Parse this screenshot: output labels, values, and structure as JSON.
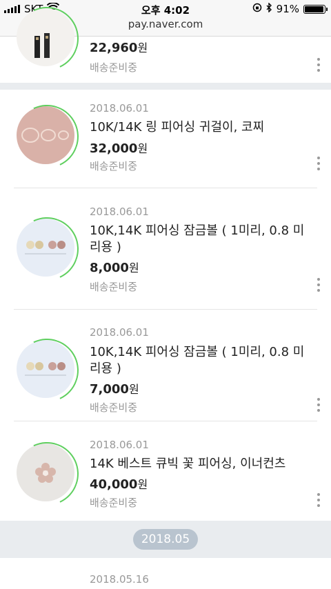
{
  "status_bar": {
    "carrier": "SKT",
    "time": "오후 4:02",
    "battery": "91%"
  },
  "url": "pay.naver.com",
  "orders_top": {
    "price": "22,960",
    "currency": "원",
    "status": "배송준비중"
  },
  "orders": [
    {
      "date": "2018.06.01",
      "title": "10K/14K 링 피어싱 귀걸이, 코찌",
      "price": "32,000",
      "currency": "원",
      "status": "배송준비중"
    },
    {
      "date": "2018.06.01",
      "title": "10K,14K 피어싱 잠금볼 ( 1미리, 0.8 미리용 )",
      "price": "8,000",
      "currency": "원",
      "status": "배송준비중"
    },
    {
      "date": "2018.06.01",
      "title": "10K,14K 피어싱 잠금볼 ( 1미리, 0.8 미리용 )",
      "price": "7,000",
      "currency": "원",
      "status": "배송준비중"
    },
    {
      "date": "2018.06.01",
      "title": "14K 베스트 큐빅 꽃 피어싱, 이너컨츠",
      "price": "40,000",
      "currency": "원",
      "status": "배송준비중"
    }
  ],
  "month_label": "2018.05",
  "next_order": {
    "date": "2018.05.16"
  },
  "colors": {
    "ring": "#5fcf5f",
    "pill": "#b9c4cf",
    "band": "#e9ecef"
  }
}
